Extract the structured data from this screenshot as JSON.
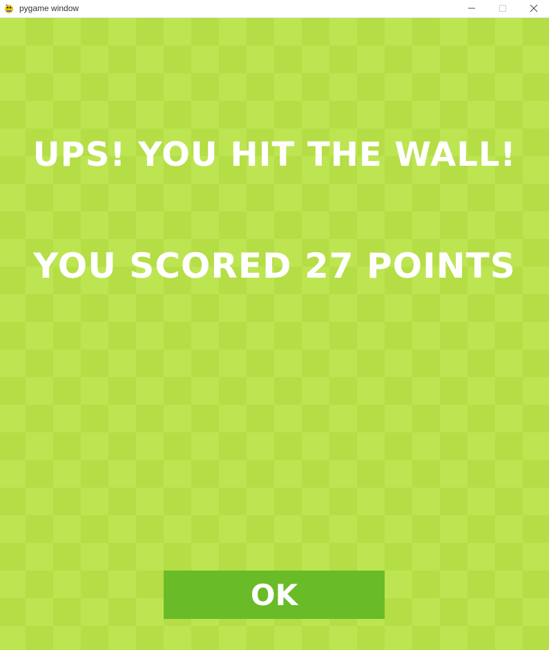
{
  "window": {
    "title": "pygame window",
    "icon": "pygame-snake-icon",
    "controls": {
      "minimize_icon": "minimize-icon",
      "maximize_icon": "maximize-icon",
      "close_icon": "close-icon"
    }
  },
  "game": {
    "colors": {
      "tile_dark": "#b5dd46",
      "tile_light": "#bde552",
      "text": "#ffffff",
      "button": "#6abb28"
    },
    "message_line1": "UPS! YOU HIT THE WALL!",
    "message_line2": "YOU SCORED 27 POINTS",
    "score": 27,
    "ok_label": "OK"
  }
}
